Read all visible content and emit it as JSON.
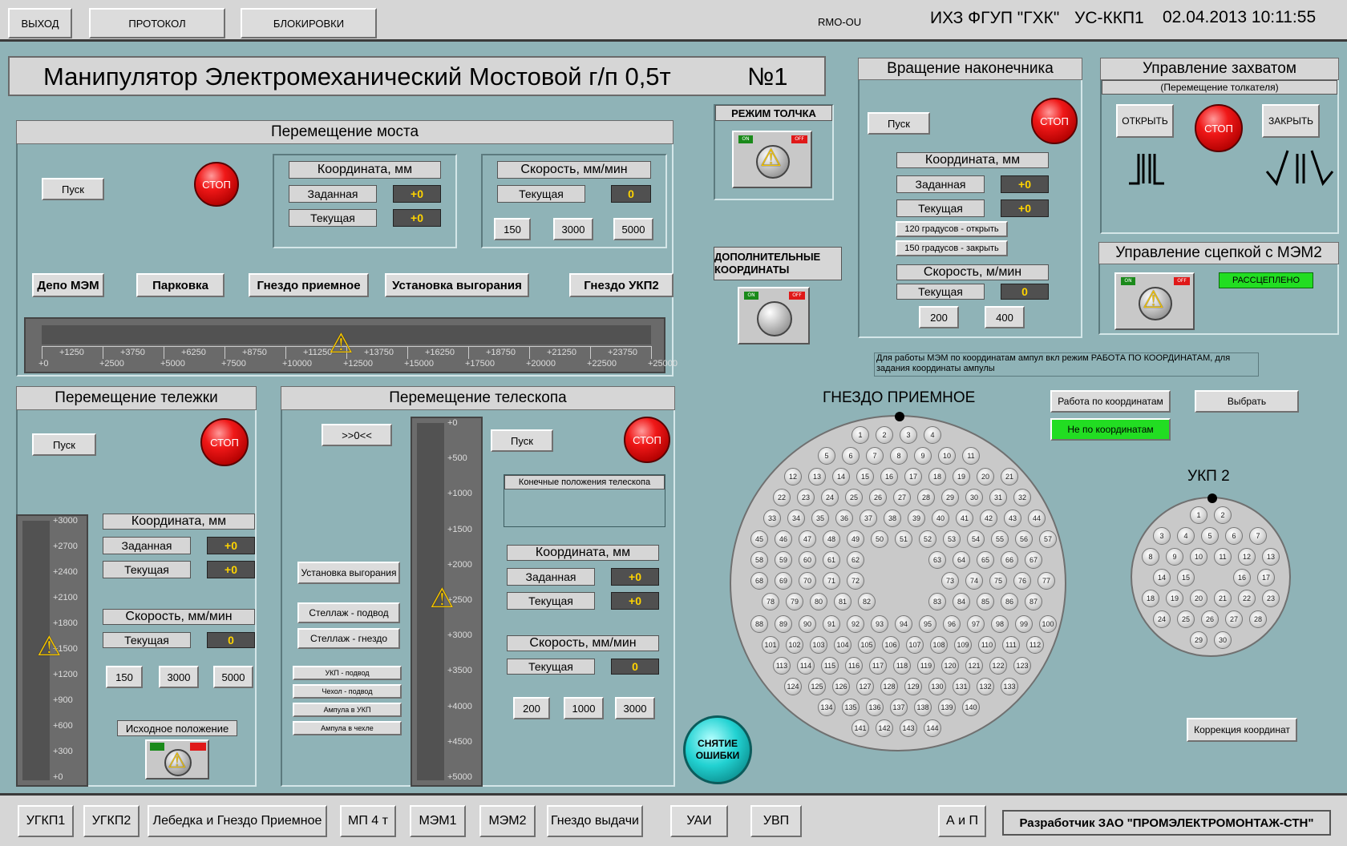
{
  "header": {
    "btn_exit": "ВЫХОД",
    "btn_protocol": "ПРОТОКОЛ",
    "btn_locks": "БЛОКИРОВКИ",
    "station": "RMO-OU",
    "org": "ИХЗ ФГУП \"ГХК\"",
    "unit": "УС-ККП1",
    "datetime": "02.04.2013 10:11:55"
  },
  "main_title": "Манипулятор Электромеханический Мостовой г/п 0,5т",
  "main_number": "№1",
  "bridge": {
    "title": "Перемещение моста",
    "start": "Пуск",
    "stop": "СТОП",
    "coord_title": "Координата, мм",
    "set_label": "Заданная",
    "set_value": "+0",
    "cur_label": "Текущая",
    "cur_value": "+0",
    "speed_title": "Скорость, мм/мин",
    "speed_cur_label": "Текущая",
    "speed_cur_value": "0",
    "speeds": [
      "150",
      "3000",
      "5000"
    ],
    "positions": [
      "Депо МЭМ",
      "Парковка",
      "Гнездо приемное",
      "Установка выгорания",
      "Гнездо УКП2"
    ],
    "scale_top": [
      "+1250",
      "+3750",
      "+6250",
      "+8750",
      "+11250",
      "+13750",
      "+16250",
      "+18750",
      "+21250",
      "+23750"
    ],
    "scale_bottom": [
      "+0",
      "+2500",
      "+5000",
      "+7500",
      "+10000",
      "+12500",
      "+15000",
      "+17500",
      "+20000",
      "+22500",
      "+25000"
    ]
  },
  "jog": {
    "title": "РЕЖИМ ТОЛЧКА",
    "on": "ON",
    "off": "OFF"
  },
  "extra_coords": {
    "title": "ДОПОЛНИТЕЛЬНЫЕ КООРДИНАТЫ",
    "on": "ON",
    "off": "OFF"
  },
  "rotation": {
    "title": "Вращение наконечника",
    "start": "Пуск",
    "stop": "СТОП",
    "coord_title": "Координата, мм",
    "set_label": "Заданная",
    "set_value": "+0",
    "cur_label": "Текущая",
    "cur_value": "+0",
    "deg_open": "120 градусов - открыть",
    "deg_close": "150 градусов - закрыть",
    "speed_title": "Скорость, м/мин",
    "speed_cur_label": "Текущая",
    "speed_cur_value": "0",
    "speeds": [
      "200",
      "400"
    ]
  },
  "grip": {
    "title": "Управление захватом",
    "subtitle": "(Перемещение толкателя)",
    "open": "ОТКРЫТЬ",
    "stop": "СТОП",
    "close": "ЗАКРЫТЬ"
  },
  "coupling": {
    "title": "Управление сцепкой с МЭМ2",
    "on": "ON",
    "off": "OFF",
    "status": "РАССЦЕПЛЕНО"
  },
  "note": "Для работы МЭМ по координатам ампул вкл режим РАБОТА ПО КООРДИНАТАМ, для задания координаты ампулы",
  "mode": {
    "by_coords": "Работа по координатам",
    "not_coords": "Не по координатам",
    "select": "Выбрать"
  },
  "trolley": {
    "title": "Перемещение тележки",
    "start": "Пуск",
    "stop": "СТОП",
    "coord_title": "Координата, мм",
    "set_label": "Заданная",
    "set_value": "+0",
    "cur_label": "Текущая",
    "cur_value": "+0",
    "speed_title": "Скорость, мм/мин",
    "speed_cur_label": "Текущая",
    "speed_cur_value": "0",
    "speeds": [
      "150",
      "3000",
      "5000"
    ],
    "home_label": "Исходное положение",
    "scale": [
      "+3000",
      "+2700",
      "+2400",
      "+2100",
      "+1800",
      "+1500",
      "+1200",
      "+900",
      "+600",
      "+300",
      "+0"
    ]
  },
  "telescope": {
    "title": "Перемещение телескопа",
    "center": ">>0<<",
    "start": "Пуск",
    "stop": "СТОП",
    "ends_label": "Конечные положения телескопа",
    "coord_title": "Координата, мм",
    "set_label": "Заданная",
    "set_value": "+0",
    "cur_label": "Текущая",
    "cur_value": "+0",
    "speed_title": "Скорость, мм/мин",
    "speed_cur_label": "Текущая",
    "speed_cur_value": "0",
    "speeds": [
      "200",
      "1000",
      "3000"
    ],
    "positions": [
      "Установка выгорания",
      "Стеллаж  - подвод",
      "Стеллаж  - гнездо"
    ],
    "small_positions": [
      "УКП  - подвод",
      "Чехол - подвод",
      "Ампула в УКП",
      "Ампула в чехле"
    ],
    "scale": [
      "+0",
      "+500",
      "+1000",
      "+1500",
      "+2000",
      "+2500",
      "+3000",
      "+3500",
      "+4000",
      "+4500",
      "+5000"
    ]
  },
  "reset_errors": "СНЯТИЕ ОШИБКИ",
  "receiver_title": "ГНЕЗДО ПРИЕМНОЕ",
  "ukp_title": "УКП 2",
  "correction": "Коррекция координат",
  "footer": {
    "nav": [
      "УГКП1",
      "УГКП2",
      "Лебедка и Гнездо Приемное",
      "МП 4 т",
      "МЭМ1",
      "МЭМ2",
      "Гнездо выдачи",
      "УАИ",
      "УВП",
      "А и П"
    ],
    "developer": "Разработчик ЗАО \"ПРОМЭЛЕКТРОМОНТАЖ-СТН\""
  },
  "colors": {
    "background": "#8fb3b7",
    "value_text": "#ffd400",
    "green_status": "#22dd22",
    "stop_red": "#e01818"
  }
}
